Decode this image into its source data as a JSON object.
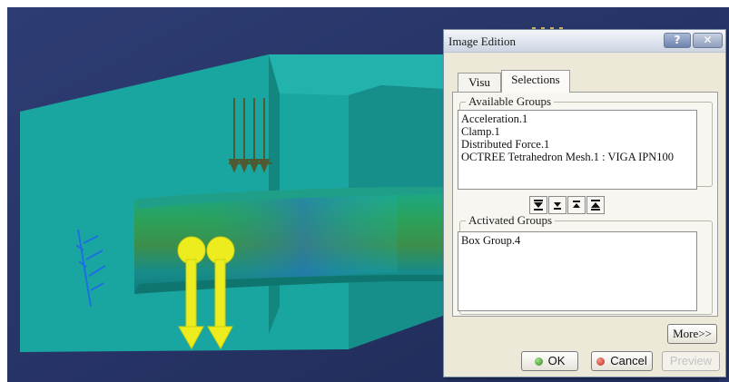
{
  "dialog": {
    "title": "Image Edition",
    "help_label": "?",
    "close_label": "✕",
    "tabs": [
      {
        "label": "Visu",
        "selected": false
      },
      {
        "label": "Selections",
        "selected": true
      }
    ],
    "available_groups": {
      "legend": "Available Groups",
      "items": [
        "Acceleration.1",
        "Clamp.1",
        "Distributed Force.1",
        "OCTREE Tetrahedron Mesh.1 : VIGA IPN100"
      ]
    },
    "move_buttons": [
      "move-all-down",
      "move-down",
      "move-up",
      "move-all-up"
    ],
    "activated_groups": {
      "legend": "Activated Groups",
      "items": [
        "Box Group.4"
      ]
    },
    "more_label": "More>>",
    "ok_label": "OK",
    "cancel_label": "Cancel",
    "preview_label": "Preview",
    "preview_enabled": false
  },
  "viewport": {
    "background_color": "#2b3a6e",
    "box_color": "#1aa6a0",
    "load_arrow_color": "#ecec1e",
    "distributed_force_color": "#4e5a32",
    "clamp_color": "#1e6fe0"
  }
}
